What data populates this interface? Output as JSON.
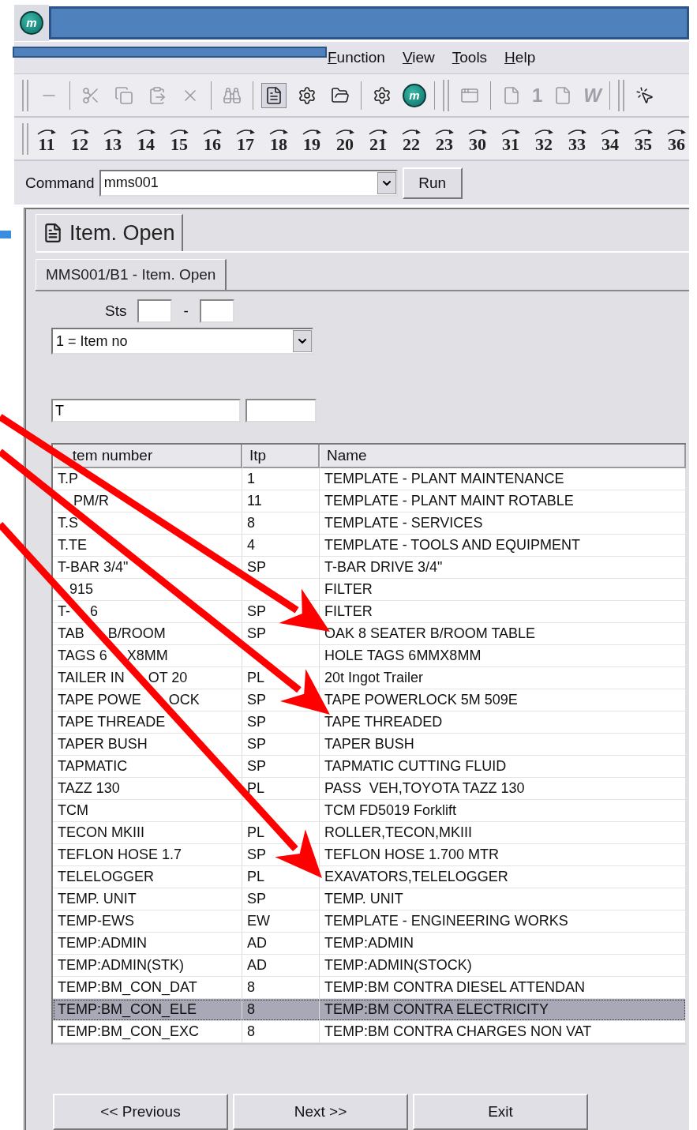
{
  "logo": "m",
  "logo_button": "m",
  "menu": [
    {
      "label": "Function"
    },
    {
      "label": "View"
    },
    {
      "label": "Tools"
    },
    {
      "label": "Help"
    }
  ],
  "toolbar_labels": [
    "1",
    "W"
  ],
  "shortcuts": [
    "11",
    "12",
    "13",
    "14",
    "15",
    "16",
    "17",
    "18",
    "19",
    "20",
    "21",
    "22",
    "23",
    "30",
    "31",
    "32",
    "33",
    "34",
    "35",
    "36"
  ],
  "command": {
    "label": "Command",
    "value": "mms001",
    "button": "Run"
  },
  "outer_tab": {
    "label": "Item. Open",
    "selected": true
  },
  "inner_tab": {
    "label": "MMS001/B1 - Item. Open",
    "selected": true
  },
  "status": {
    "label": "Sts",
    "separator": "-"
  },
  "sort_select": {
    "value": "1 = Item no"
  },
  "filter": {
    "value": "T"
  },
  "table": {
    "columns": [
      "   tem number",
      "Itp",
      "Name"
    ],
    "rows": [
      {
        "cells": [
          "T.P",
          "1",
          "TEMPLATE - PLANT MAINTENANCE"
        ],
        "selected": false
      },
      {
        "cells": [
          "    PM/R",
          "11",
          "TEMPLATE - PLANT MAINT ROTABLE"
        ],
        "selected": false
      },
      {
        "cells": [
          "T.S",
          "8",
          "TEMPLATE - SERVICES"
        ],
        "selected": false
      },
      {
        "cells": [
          "T.TE",
          "4",
          "TEMPLATE - TOOLS AND EQUIPMENT"
        ],
        "selected": false
      },
      {
        "cells": [
          "T-BAR 3/4\"",
          "SP",
          "T-BAR DRIVE 3/4\""
        ],
        "selected": false
      },
      {
        "cells": [
          "   915",
          null,
          "FILTER"
        ],
        "selected": false
      },
      {
        "cells": [
          "T-     6",
          "SP",
          "FILTER"
        ],
        "selected": false
      },
      {
        "cells": [
          "TAB      B/ROOM",
          "SP",
          "OAK 8 SEATER B/ROOM TABLE"
        ],
        "selected": false
      },
      {
        "cells": [
          "TAGS 6     X8MM",
          null,
          "HOLE TAGS 6MMX8MM"
        ],
        "selected": false
      },
      {
        "cells": [
          "TAILER IN      OT 20",
          "PL",
          "20t Ingot Trailer"
        ],
        "selected": false
      },
      {
        "cells": [
          "TAPE POWE       OCK",
          "SP",
          "TAPE POWERLOCK 5M 509E"
        ],
        "selected": false
      },
      {
        "cells": [
          "TAPE THREADE",
          "SP",
          "TAPE THREADED"
        ],
        "selected": false
      },
      {
        "cells": [
          "TAPER BUSH",
          "SP",
          "TAPER BUSH"
        ],
        "selected": false
      },
      {
        "cells": [
          "TAPMATIC",
          "SP",
          "TAPMATIC CUTTING FLUID"
        ],
        "selected": false
      },
      {
        "cells": [
          "TAZZ 130",
          "PL",
          "PASS  VEH,TOYOTA TAZZ 130"
        ],
        "selected": false
      },
      {
        "cells": [
          "TCM",
          null,
          "TCM FD5019 Forklift"
        ],
        "selected": false
      },
      {
        "cells": [
          "TECON MKIII",
          "PL",
          "ROLLER,TECON,MKIII"
        ],
        "selected": false
      },
      {
        "cells": [
          "TEFLON HOSE 1.7",
          "SP",
          "TEFLON HOSE 1.700 MTR"
        ],
        "selected": false
      },
      {
        "cells": [
          "TELELOGGER",
          "PL",
          "EXAVATORS,TELELOGGER"
        ],
        "selected": false
      },
      {
        "cells": [
          "TEMP. UNIT",
          "SP",
          "TEMP. UNIT"
        ],
        "selected": false
      },
      {
        "cells": [
          "TEMP-EWS",
          "EW",
          "TEMPLATE - ENGINEERING WORKS"
        ],
        "selected": false
      },
      {
        "cells": [
          "TEMP:ADMIN",
          "AD",
          "TEMP:ADMIN"
        ],
        "selected": false
      },
      {
        "cells": [
          "TEMP:ADMIN(STK)",
          "AD",
          "TEMP:ADMIN(STOCK)"
        ],
        "selected": false
      },
      {
        "cells": [
          "TEMP:BM_CON_DAT",
          "8",
          "TEMP:BM CONTRA DIESEL ATTENDAN"
        ],
        "selected": false
      },
      {
        "cells": [
          "TEMP:BM_CON_ELE",
          "8",
          "TEMP:BM CONTRA ELECTRICITY"
        ],
        "selected": true
      },
      {
        "cells": [
          "TEMP:BM_CON_EXC",
          "8",
          "TEMP:BM CONTRA CHARGES NON VAT"
        ],
        "selected": false
      }
    ]
  },
  "buttons": [
    "<< Previous",
    "Next >>",
    "Exit"
  ]
}
